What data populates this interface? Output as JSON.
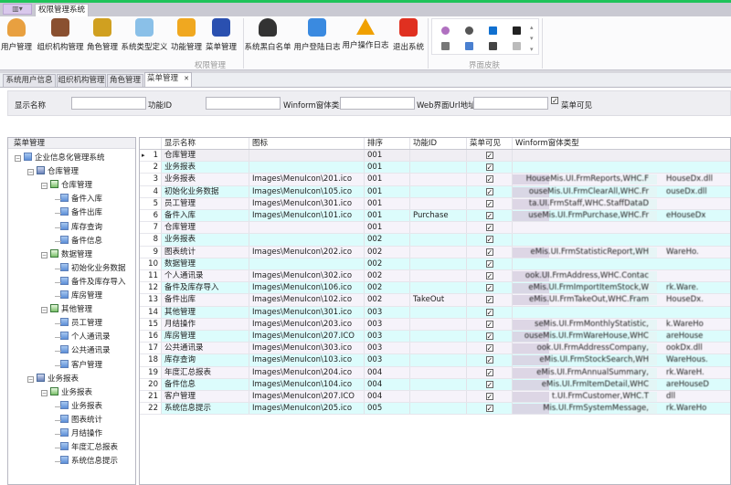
{
  "title_tab": "权限管理系统",
  "ribbon": {
    "buttons": [
      {
        "label": "用户管理",
        "icon": "user-icon",
        "color": "#e8a040"
      },
      {
        "label": "组织机构管理",
        "icon": "organization-icon",
        "color": "#8a5030"
      },
      {
        "label": "角色管理",
        "icon": "role-key-icon",
        "color": "#d0a020"
      },
      {
        "label": "系统类型定义",
        "icon": "system-type-icon",
        "color": "#8ac0e8"
      },
      {
        "label": "功能管理",
        "icon": "key-icon",
        "color": "#f0a820"
      },
      {
        "label": "菜单管理",
        "icon": "menu-icon",
        "color": "#2a50b0"
      },
      {
        "label": "系统黑白名单",
        "icon": "blacklist-user-icon",
        "color": "#333333"
      },
      {
        "label": "用户登陆日志",
        "icon": "login-log-icon",
        "color": "#3a8ae0"
      },
      {
        "label": "用户操作日志",
        "icon": "warning-icon",
        "color": "#f0a000"
      },
      {
        "label": "退出系统",
        "icon": "exit-icon",
        "color": "#e03020"
      }
    ],
    "group1_label": "权限管理",
    "group2_label": "界面皮肤",
    "skins": [
      "skin-purple-icon",
      "skin-dark-icon",
      "skin-office-blue-icon",
      "skin-office-black-icon",
      "skin-office-white-icon",
      "skin-metro-blue-icon",
      "skin-metro-dark-icon",
      "skin-metro-light-icon"
    ]
  },
  "doc_tabs": [
    {
      "label": "系统用户信息"
    },
    {
      "label": "组织机构管理"
    },
    {
      "label": "角色管理"
    },
    {
      "label": "菜单管理",
      "active": true
    }
  ],
  "close_glyph": "✕",
  "filter": {
    "display_name_label": "显示名称",
    "display_name_value": "",
    "function_id_label": "功能ID",
    "function_id_value": "",
    "winform_label": "Winform窗体类型",
    "winform_value": "",
    "weburl_label": "Web界面Url地址",
    "weburl_value": "",
    "menu_visible_label": "菜单可见",
    "menu_visible_checked": true
  },
  "tree": {
    "header": "菜单管理",
    "nodes": [
      {
        "label": "企业信息化管理系统",
        "level": 0,
        "type": "root"
      },
      {
        "label": "仓库管理",
        "level": 1,
        "type": "r"
      },
      {
        "label": "仓库管理",
        "level": 2,
        "type": "g"
      },
      {
        "label": "备件入库",
        "level": 3
      },
      {
        "label": "备件出库",
        "level": 3
      },
      {
        "label": "库存查询",
        "level": 3
      },
      {
        "label": "备件信息",
        "level": 3
      },
      {
        "label": "数据管理",
        "level": 2,
        "type": "g"
      },
      {
        "label": "初始化业务数据",
        "level": 3
      },
      {
        "label": "备件及库存导入",
        "level": 3
      },
      {
        "label": "库房管理",
        "level": 3
      },
      {
        "label": "其他管理",
        "level": 2,
        "type": "g"
      },
      {
        "label": "员工管理",
        "level": 3
      },
      {
        "label": "个人通讯录",
        "level": 3
      },
      {
        "label": "公共通讯录",
        "level": 3
      },
      {
        "label": "客户管理",
        "level": 3
      },
      {
        "label": "业务报表",
        "level": 1,
        "type": "r"
      },
      {
        "label": "业务报表",
        "level": 2,
        "type": "g"
      },
      {
        "label": "业务报表",
        "level": 3
      },
      {
        "label": "图表统计",
        "level": 3
      },
      {
        "label": "月结操作",
        "level": 3
      },
      {
        "label": "年度汇总报表",
        "level": 3
      },
      {
        "label": "系统信息提示",
        "level": 3
      }
    ]
  },
  "grid": {
    "columns": [
      "显示名称",
      "图标",
      "排序",
      "功能ID",
      "菜单可见",
      "Winform窗体类型"
    ],
    "check_glyph": "✓",
    "selected_glyph": "▸",
    "rows": [
      {
        "n": "1",
        "name": "仓库管理",
        "icon": "",
        "sort": "001",
        "fid": "",
        "vis": true,
        "wf": ""
      },
      {
        "n": "2",
        "name": "业务报表",
        "icon": "",
        "sort": "001",
        "fid": "",
        "vis": true,
        "wf": ""
      },
      {
        "n": "3",
        "name": "业务报表",
        "icon": "Images\\MenuIcon\\201.ico",
        "sort": "001",
        "fid": "",
        "vis": true,
        "wf": "HouseMis.UI.FrmReports,WHC.F",
        "wf2": "HouseDx.dll"
      },
      {
        "n": "4",
        "name": "初始化业务数据",
        "icon": "Images\\MenuIcon\\105.ico",
        "sort": "001",
        "fid": "",
        "vis": true,
        "wf": "ouseMis.UI.FrmClearAll,WHC.Fr",
        "wf2": "ouseDx.dll"
      },
      {
        "n": "5",
        "name": "员工管理",
        "icon": "Images\\MenuIcon\\301.ico",
        "sort": "001",
        "fid": "",
        "vis": true,
        "wf": "ta.UI.FrmStaff,WHC.StaffDataD",
        "wf2": ""
      },
      {
        "n": "6",
        "name": "备件入库",
        "icon": "Images\\MenuIcon\\101.ico",
        "sort": "001",
        "fid": "Purchase",
        "vis": true,
        "wf": "useMis.UI.FrmPurchase,WHC.Fr",
        "wf2": "eHouseDx"
      },
      {
        "n": "7",
        "name": "仓库管理",
        "icon": "",
        "sort": "001",
        "fid": "",
        "vis": true,
        "wf": ""
      },
      {
        "n": "8",
        "name": "业务报表",
        "icon": "",
        "sort": "002",
        "fid": "",
        "vis": true,
        "wf": ""
      },
      {
        "n": "9",
        "name": "图表统计",
        "icon": "Images\\MenuIcon\\202.ico",
        "sort": "002",
        "fid": "",
        "vis": true,
        "wf": "eMis.UI.FrmStatisticReport,WH",
        "wf2": "WareHo."
      },
      {
        "n": "10",
        "name": "数据管理",
        "icon": "",
        "sort": "002",
        "fid": "",
        "vis": true,
        "wf": ""
      },
      {
        "n": "11",
        "name": "个人通讯录",
        "icon": "Images\\MenuIcon\\302.ico",
        "sort": "002",
        "fid": "",
        "vis": true,
        "wf": "ook.UI.FrmAddress,WHC.Contac",
        "wf2": ""
      },
      {
        "n": "12",
        "name": "备件及库存导入",
        "icon": "Images\\MenuIcon\\106.ico",
        "sort": "002",
        "fid": "",
        "vis": true,
        "wf": "eMis.UI.FrmImportItemStock,W",
        "wf2": "rk.Ware."
      },
      {
        "n": "13",
        "name": "备件出库",
        "icon": "Images\\MenuIcon\\102.ico",
        "sort": "002",
        "fid": "TakeOut",
        "vis": true,
        "wf": "eMis.UI.FrmTakeOut,WHC.Fram",
        "wf2": "HouseDx."
      },
      {
        "n": "14",
        "name": "其他管理",
        "icon": "Images\\MenuIcon\\301.ico",
        "sort": "003",
        "fid": "",
        "vis": true,
        "wf": ""
      },
      {
        "n": "15",
        "name": "月结操作",
        "icon": "Images\\MenuIcon\\203.ico",
        "sort": "003",
        "fid": "",
        "vis": true,
        "wf": "seMis.UI.FrmMonthlyStatistic,",
        "wf2": "k.WareHo"
      },
      {
        "n": "16",
        "name": "库房管理",
        "icon": "Images\\MenuIcon\\207.ICO",
        "sort": "003",
        "fid": "",
        "vis": true,
        "wf": "ouseMis.UI.FrmWareHouse,WHC",
        "wf2": "areHouse"
      },
      {
        "n": "17",
        "name": "公共通讯录",
        "icon": "Images\\MenuIcon\\303.ico",
        "sort": "003",
        "fid": "",
        "vis": true,
        "wf": "ook.UI.FrmAddressCompany,",
        "wf2": "ookDx.dll"
      },
      {
        "n": "18",
        "name": "库存查询",
        "icon": "Images\\MenuIcon\\103.ico",
        "sort": "003",
        "fid": "",
        "vis": true,
        "wf": "eMis.UI.FrmStockSearch,WH",
        "wf2": "WareHous."
      },
      {
        "n": "19",
        "name": "年度汇总报表",
        "icon": "Images\\MenuIcon\\204.ico",
        "sort": "004",
        "fid": "",
        "vis": true,
        "wf": "eMis.UI.FrmAnnualSummary,",
        "wf2": "rk.WareH."
      },
      {
        "n": "20",
        "name": "备件信息",
        "icon": "Images\\MenuIcon\\104.ico",
        "sort": "004",
        "fid": "",
        "vis": true,
        "wf": "eMis.UI.FrmItemDetail,WHC",
        "wf2": "areHouseD"
      },
      {
        "n": "21",
        "name": "客户管理",
        "icon": "Images\\MenuIcon\\207.ICO",
        "sort": "004",
        "fid": "",
        "vis": true,
        "wf": "t.UI.FrmCustomer,WHC.T",
        "wf2": "dll"
      },
      {
        "n": "22",
        "name": "系统信息提示",
        "icon": "Images\\MenuIcon\\205.ico",
        "sort": "005",
        "fid": "",
        "vis": true,
        "wf": "Mis.UI.FrmSystemMessage,",
        "wf2": "rk.WareHo"
      }
    ]
  }
}
